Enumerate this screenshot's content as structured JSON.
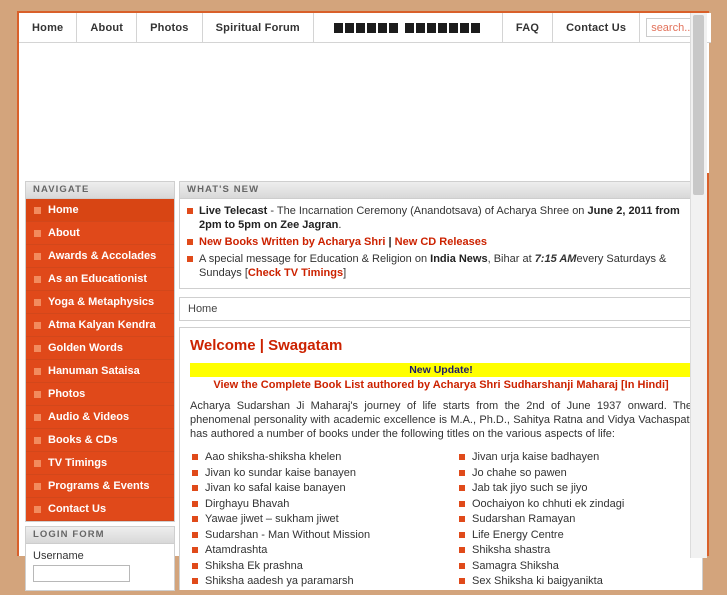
{
  "topnav": {
    "items": [
      {
        "label": "Home",
        "hindi": false
      },
      {
        "label": "About",
        "hindi": false
      },
      {
        "label": "Photos",
        "hindi": false
      },
      {
        "label": "Spiritual Forum",
        "hindi": false
      },
      {
        "label": "■■■■■■ ■■■■■■■",
        "hindi": true
      },
      {
        "label": "FAQ",
        "hindi": false
      },
      {
        "label": "Contact Us",
        "hindi": false
      }
    ],
    "search_placeholder": "search...",
    "search_value": ""
  },
  "sidebar": {
    "navigate_header": "NAVIGATE",
    "items": [
      {
        "label": "Home",
        "active": true
      },
      {
        "label": "About",
        "active": false
      },
      {
        "label": "Awards & Accolades",
        "active": false
      },
      {
        "label": "As an Educationist",
        "active": false
      },
      {
        "label": "Yoga & Metaphysics",
        "active": false
      },
      {
        "label": "Atma Kalyan Kendra",
        "active": false
      },
      {
        "label": "Golden Words",
        "active": false
      },
      {
        "label": "Hanuman Sataisa",
        "active": false
      },
      {
        "label": "Photos",
        "active": false
      },
      {
        "label": "Audio & Videos",
        "active": false
      },
      {
        "label": "Books & CDs",
        "active": false
      },
      {
        "label": "TV Timings",
        "active": false
      },
      {
        "label": "Programs & Events",
        "active": false
      },
      {
        "label": "Contact Us",
        "active": false
      }
    ],
    "login": {
      "header": "LOGIN FORM",
      "username_label": "Username",
      "username_value": ""
    }
  },
  "whatsnew": {
    "header": "WHAT'S NEW",
    "items": [
      {
        "parts": [
          {
            "t": "Live Telecast",
            "s": "b"
          },
          {
            "t": " - The Incarnation Ceremony (Anandotsava) of Acharya Shree on ",
            "s": ""
          },
          {
            "t": "June 2, 2011 from 2pm to 5pm on Zee Jagran",
            "s": "b"
          },
          {
            "t": ".",
            "s": ""
          }
        ]
      },
      {
        "parts": [
          {
            "t": "New Books Written by Acharya Shri",
            "s": "lnk"
          },
          {
            "t": " | ",
            "s": "b"
          },
          {
            "t": "New CD Releases",
            "s": "lnk"
          }
        ]
      },
      {
        "parts": [
          {
            "t": "A special message for Education & Religion on ",
            "s": ""
          },
          {
            "t": "India News",
            "s": "b"
          },
          {
            "t": ", Bihar at ",
            "s": ""
          },
          {
            "t": "7:15 AM",
            "s": "i"
          },
          {
            "t": "every Saturdays & Sundays [",
            "s": ""
          },
          {
            "t": "Check TV Timings",
            "s": "lnk"
          },
          {
            "t": "]",
            "s": ""
          }
        ]
      }
    ]
  },
  "breadcrumb": "Home",
  "article": {
    "title": "Welcome | Swagatam",
    "update_banner": "New Update!",
    "update_sub": "View the Complete Book List authored by Acharya Shri Sudharshanji Maharaj [In Hindi]",
    "intro": "Acharya Sudarshan Ji Maharaj's journey of life starts from the 2nd of June 1937 onward. The phenomenal personality with academic excellence is M.A., Ph.D., Sahitya Ratna and Vidya Vachaspati has authored a number of books under the following titles on the various aspects of life:",
    "books_left": [
      "Aao shiksha-shiksha khelen",
      "Jivan ko sundar kaise banayen",
      "Jivan ko safal kaise banayen",
      "Dirghayu Bhavah",
      "Yawae jiwet – sukham jiwet",
      "Sudarshan - Man Without Mission",
      "Atamdrashta",
      "Shiksha Ek prashna",
      "Shiksha aadesh ya paramarsh"
    ],
    "books_right": [
      "Jivan urja kaise badhayen",
      "Jo chahe so pawen",
      "Jab tak jiyo such se jiyo",
      "Oochaiyon ko chhuti ek zindagi",
      "Sudarshan Ramayan",
      "Life Energy Centre",
      "Shiksha shastra",
      "Samagra Shiksha",
      "Sex Shiksha ki baigyanikta"
    ]
  },
  "colors": {
    "page_bg": "#d3a47c",
    "accent_orange": "#d9602a",
    "sidebar_orange": "#e0491a",
    "link_red": "#cc2200",
    "bullet_orange": "#e04a1a",
    "highlight_yellow": "#ffff00"
  }
}
